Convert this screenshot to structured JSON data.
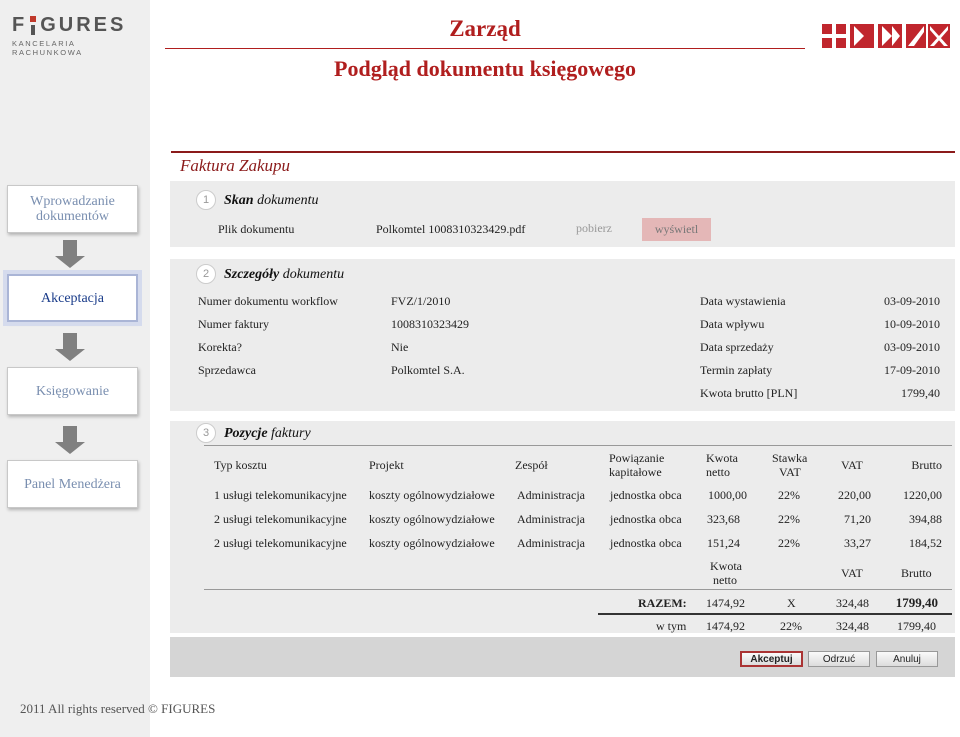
{
  "logo": {
    "name_left": "F",
    "name_right": "GURES",
    "tagline": "KANCELARIA RACHUNKOWA"
  },
  "header": {
    "title": "Zarząd",
    "subtitle": "Podgląd dokumentu księgowego"
  },
  "colors": {
    "accent": "#b01e1e",
    "panel_bg": "#ececec",
    "sidebar_bg": "#efefef",
    "nav_active": "#1a3c8a",
    "nav_inactive": "#7a8fb0"
  },
  "nav": {
    "items": [
      {
        "label": "Wprowadzanie dokumentów",
        "active": false
      },
      {
        "label": "Akceptacja",
        "active": true
      },
      {
        "label": "Księgowanie",
        "active": false
      },
      {
        "label": "Panel Menedżera",
        "active": false
      }
    ]
  },
  "footer": {
    "text": "2011 All rights reserved © FIGURES"
  },
  "section": {
    "title": "Faktura Zakupu"
  },
  "step1": {
    "num": "1",
    "title_bold": "Skan",
    "title_rest": " dokumentu",
    "file_label": "Plik dokumentu",
    "file_name": "Polkomtel 1008310323429.pdf",
    "download": "pobierz",
    "view": "wyświetl"
  },
  "step2": {
    "num": "2",
    "title_bold": "Szczegóły",
    "title_rest": " dokumentu",
    "left": [
      {
        "label": "Numer dokumentu workflow",
        "value": "FVZ/1/2010"
      },
      {
        "label": "Numer faktury",
        "value": "1008310323429"
      },
      {
        "label": "Korekta?",
        "value": "Nie"
      },
      {
        "label": "Sprzedawca",
        "value": "Polkomtel S.A."
      }
    ],
    "right": [
      {
        "label": "Data wystawienia",
        "value": "03-09-2010"
      },
      {
        "label": "Data wpływu",
        "value": "10-09-2010"
      },
      {
        "label": "Data sprzedaży",
        "value": "03-09-2010"
      },
      {
        "label": "Termin zapłaty",
        "value": "17-09-2010"
      },
      {
        "label": "Kwota brutto [PLN]",
        "value": "1799,40"
      }
    ]
  },
  "step3": {
    "num": "3",
    "title_bold": "Pozycje",
    "title_rest": " faktury",
    "headers": {
      "typ": "Typ kosztu",
      "projekt": "Projekt",
      "zespol": "Zespół",
      "powiazanie_1": "Powiązanie",
      "powiazanie_2": "kapitałowe",
      "netto_1": "Kwota",
      "netto_2": "netto",
      "stawka_1": "Stawka",
      "stawka_2": "VAT",
      "vat": "VAT",
      "brutto": "Brutto"
    },
    "rows": [
      {
        "typ": "1 usługi telekomunikacyjne",
        "projekt": "koszty ogólnowydziałowe",
        "zespol": "Administracja",
        "powiazanie": "jednostka obca",
        "netto": "1000,00",
        "stawka": "22%",
        "vat": "220,00",
        "brutto": "1220,00"
      },
      {
        "typ": "2 usługi telekomunikacyjne",
        "projekt": "koszty ogólnowydziałowe",
        "zespol": "Administracja",
        "powiazanie": "jednostka obca",
        "netto": "323,68",
        "stawka": "22%",
        "vat": "71,20",
        "brutto": "394,88"
      },
      {
        "typ": "2 usługi telekomunikacyjne",
        "projekt": "koszty ogólnowydziałowe",
        "zespol": "Administracja",
        "powiazanie": "jednostka obca",
        "netto": "151,24",
        "stawka": "22%",
        "vat": "33,27",
        "brutto": "184,52"
      }
    ],
    "summary_headers": {
      "netto_1": "Kwota",
      "netto_2": "netto",
      "vat": "VAT",
      "brutto": "Brutto"
    },
    "total": {
      "label": "RAZEM:",
      "netto": "1474,92",
      "stawka": "X",
      "vat": "324,48",
      "brutto": "1799,40"
    },
    "breakdown": {
      "label": "w tym",
      "netto": "1474,92",
      "stawka": "22%",
      "vat": "324,48",
      "brutto": "1799,40"
    }
  },
  "actions": {
    "accept": "Akceptuj",
    "reject": "Odrzuć",
    "cancel": "Anuluj"
  }
}
